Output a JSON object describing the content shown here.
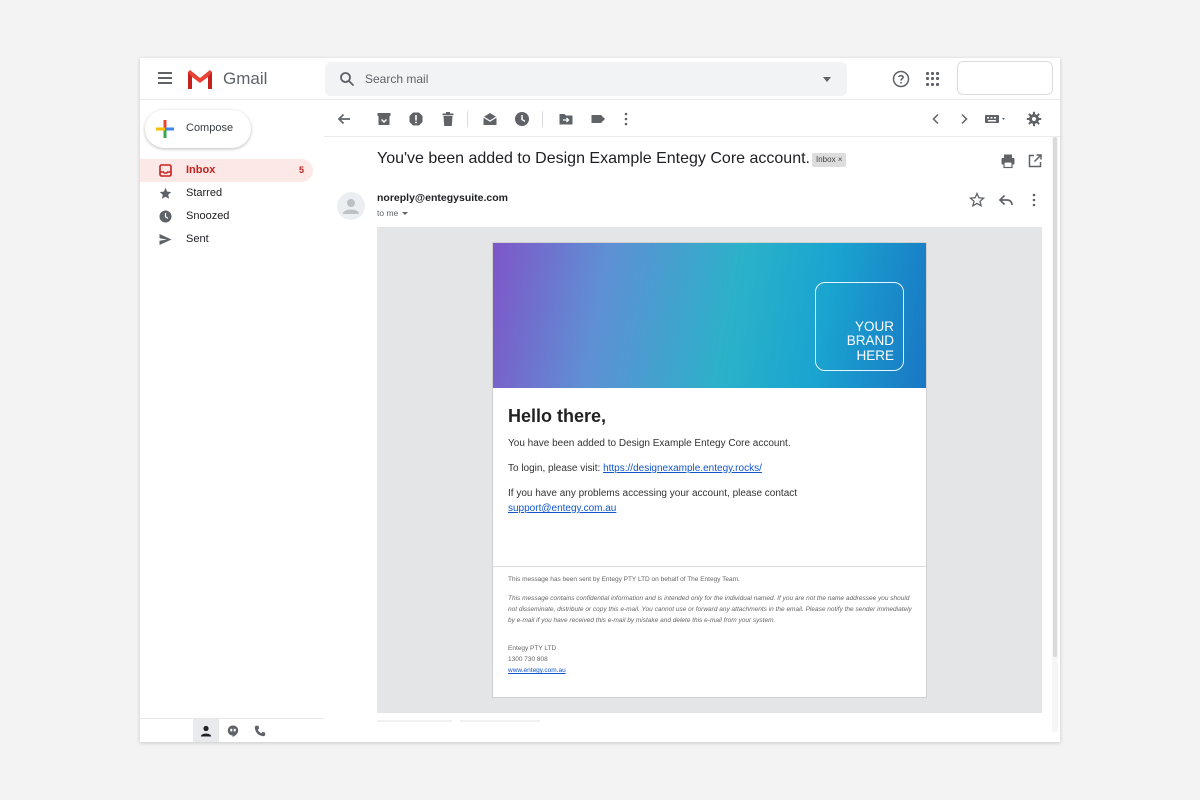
{
  "app": {
    "name": "Gmail"
  },
  "colors": {
    "inbox_active_bg": "#fce8e6",
    "inbox_active_text": "#c5221f",
    "link": "#1155cc",
    "gmail_red": "#ea4335"
  },
  "header": {
    "logo_text": "Gmail",
    "search": {
      "placeholder": "Search mail",
      "icon": "search-icon"
    },
    "icons": [
      "menu-icon",
      "help-icon",
      "apps-icon"
    ]
  },
  "sidebar": {
    "compose_label": "Compose",
    "items": [
      {
        "label": "Inbox",
        "count": "5",
        "icon": "inbox-icon",
        "active": true
      },
      {
        "label": "Starred",
        "count": "",
        "icon": "star-icon",
        "active": false
      },
      {
        "label": "Snoozed",
        "count": "",
        "icon": "clock-icon",
        "active": false
      },
      {
        "label": "Sent",
        "count": "",
        "icon": "send-icon",
        "active": false
      }
    ],
    "bottom_tabs": [
      "person-icon",
      "hangouts-icon",
      "phone-icon"
    ]
  },
  "toolbar": {
    "icons": [
      "back-arrow-icon",
      "archive-icon",
      "report-spam-icon",
      "delete-icon",
      "mark-unread-icon",
      "snooze-icon",
      "move-to-icon",
      "label-icon",
      "more-vert-icon",
      "newer-icon",
      "older-icon",
      "keyboard-icon",
      "settings-icon"
    ]
  },
  "message": {
    "subject": "You've been added to Design Example Entegy Core account.",
    "label_badge": "Inbox ×",
    "sender": "noreply@entegysuite.com",
    "recipient": "to me",
    "icons": [
      "print-icon",
      "open-in-new-icon",
      "star-outline-icon",
      "reply-icon",
      "more-vert-icon"
    ]
  },
  "email": {
    "brand_lines": [
      "YOUR",
      "BRAND",
      "HERE"
    ],
    "greeting": "Hello there,",
    "line1": "You have been added to Design Example Entegy Core account.",
    "line2_prefix": "To login, please visit: ",
    "login_link": "https://designexample.entegy.rocks/",
    "line3": "If you have any problems accessing your account, please contact",
    "support_link": "support@entegy.com.au",
    "footer_sent": "This message has been sent by Entegy PTY LTD on behalf of The Entegy Team.",
    "footer_confidential": "This message contains confidential information and is intended only for the individual named. If you are not the name addressee you should not disseminate, distribute or copy this e-mail. You cannot use or forward any attachments in the email. Please notify the sender immediately by e-mail if you have received this e-mail by mistake and delete this e-mail from your system.",
    "company": "Entegy PTY LTD",
    "phone": "1300 730 808",
    "website": "www.entegy.com.au"
  }
}
